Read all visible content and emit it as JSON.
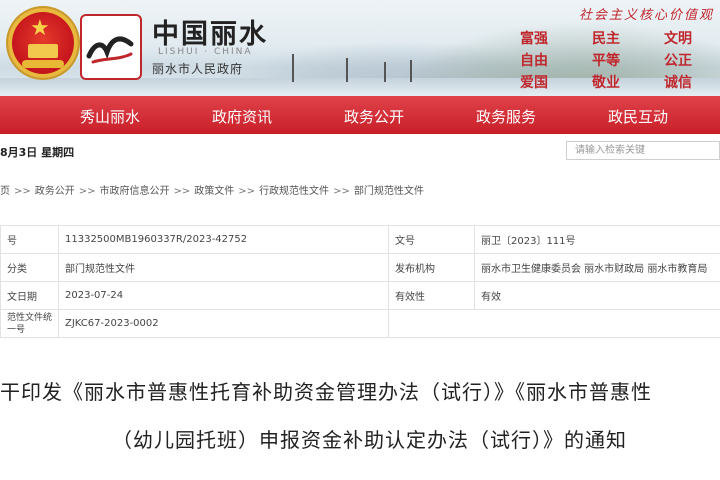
{
  "header": {
    "site_title": "中国丽水",
    "site_subtitle": "LISHUI · CHINA",
    "site_gov": "丽水市人民政府",
    "slogan": "社会主义核心价值观",
    "core_values": [
      "富强",
      "民主",
      "文明",
      "自由",
      "平等",
      "公正",
      "爱国",
      "敬业",
      "诚信"
    ],
    "brand_color": "#c81f29"
  },
  "nav": {
    "items": [
      "秀山丽水",
      "政府资讯",
      "政务公开",
      "政务服务",
      "政民互动"
    ]
  },
  "infobar": {
    "date": "8月3日 星期四",
    "search_placeholder": "请输入检索关键"
  },
  "breadcrumb": {
    "items": [
      "页",
      "政务公开",
      "市政府信息公开",
      "政策文件",
      "行政规范性文件",
      "部门规范性文件"
    ],
    "separator": ">>"
  },
  "meta": {
    "rows": [
      {
        "k1": "号",
        "v1": "11332500MB1960337R/2023-42752",
        "k2": "文号",
        "v2": "丽卫〔2023〕111号"
      },
      {
        "k1": "分类",
        "v1": "部门规范性文件",
        "k2": "发布机构",
        "v2": "丽水市卫生健康委员会 丽水市财政局 丽水市教育局"
      },
      {
        "k1": "文日期",
        "v1": "2023-07-24",
        "k2": "有效性",
        "v2": "有效"
      },
      {
        "k1": "范性文件统一号",
        "v1": "ZJKC67-2023-0002",
        "k2": "",
        "v2": ""
      }
    ]
  },
  "document": {
    "title_line1": "干印发《丽水市普惠性托育补助资金管理办法（试行）》《丽水市普惠性",
    "title_line2": "（幼儿园托班）申报资金补助认定办法（试行）》的通知"
  }
}
